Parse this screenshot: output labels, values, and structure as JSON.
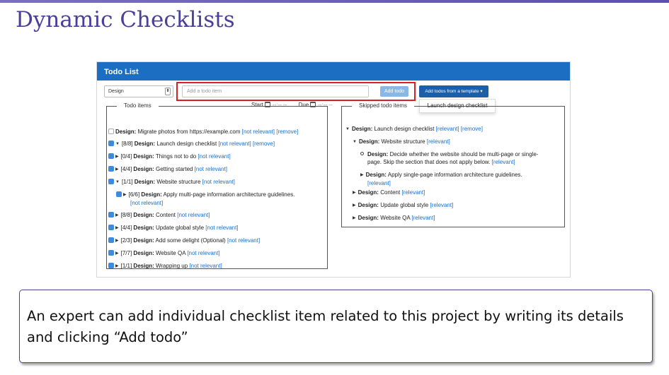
{
  "slide": {
    "title": "Dynamic Checklists",
    "caption": "An expert can add individual checklist item related to this project by writing its details and clicking “Add todo”"
  },
  "app": {
    "title": "Todo List",
    "category_select": "Design",
    "todo_input_placeholder": "Add a todo item",
    "add_button": "Add todo",
    "template_button": "Add todos from a template ▾",
    "template_menu_item": "Launch design checklist",
    "start_label": "Start",
    "due_label": "Due",
    "time_placeholder": "--:-- --"
  },
  "todo_items": {
    "legend": "Todo items",
    "items": [
      {
        "level": 0,
        "check": "off",
        "expand": "",
        "count": "",
        "prefix": "Design:",
        "text": "Migrate photos from https://example.com",
        "links": "[not relevant] [remove]"
      },
      {
        "level": 0,
        "check": "on",
        "expand": "▼",
        "count": "[8/8]",
        "prefix": "Design:",
        "text": "Launch design checklist",
        "links": "[not relevant] [remove]"
      },
      {
        "level": 1,
        "check": "on",
        "expand": "▶",
        "count": "[0/4]",
        "prefix": "Design:",
        "text": "Things not to do",
        "links": "[not relevant]"
      },
      {
        "level": 1,
        "check": "on",
        "expand": "▶",
        "count": "[4/4]",
        "prefix": "Design:",
        "text": "Getting started",
        "links": "[not relevant]"
      },
      {
        "level": 1,
        "check": "on",
        "expand": "▼",
        "count": "[1/1]",
        "prefix": "Design:",
        "text": "Website structure",
        "links": "[not relevant]"
      },
      {
        "level": 2,
        "check": "on",
        "expand": "▶",
        "count": "[6/6]",
        "prefix": "Design:",
        "text": "Apply multi-page information architecture guidelines.",
        "links": "[not relevant]"
      },
      {
        "level": 1,
        "check": "on",
        "expand": "▶",
        "count": "[8/8]",
        "prefix": "Design:",
        "text": "Content",
        "links": "[not relevant]"
      },
      {
        "level": 1,
        "check": "on",
        "expand": "▶",
        "count": "[4/4]",
        "prefix": "Design:",
        "text": "Update global style",
        "links": "[not relevant]"
      },
      {
        "level": 1,
        "check": "on",
        "expand": "▶",
        "count": "[2/3]",
        "prefix": "Design:",
        "text": "Add some delight (Optional)",
        "links": "[not relevant]"
      },
      {
        "level": 1,
        "check": "on",
        "expand": "▶",
        "count": "[7/7]",
        "prefix": "Design:",
        "text": "Website QA",
        "links": "[not relevant]"
      },
      {
        "level": 1,
        "check": "on",
        "expand": "▶",
        "count": "[1/1]",
        "prefix": "Design:",
        "text": "Wrapping up",
        "links": "[not relevant]"
      }
    ]
  },
  "skipped_items": {
    "legend": "Skipped todo items",
    "items": [
      {
        "level": 0,
        "marker": "▼",
        "prefix": "Design:",
        "text": "Launch design checklist",
        "links": "[relevant] [remove]"
      },
      {
        "level": 1,
        "marker": "▼",
        "prefix": "Design:",
        "text": "Website structure",
        "links": "[relevant]"
      },
      {
        "level": 2,
        "marker": "bullet",
        "prefix": "Design:",
        "text": "Decide whether the website should be multi-page or single-",
        "text2": "page. Skip the section that does not apply below.",
        "links": "[relevant]"
      },
      {
        "level": 2,
        "marker": "▶",
        "prefix": "Design:",
        "text": "Apply single-page information architecture guidelines.",
        "links": "[relevant]"
      },
      {
        "level": 1,
        "marker": "▶",
        "prefix": "Design:",
        "text": "Content",
        "links": "[relevant]"
      },
      {
        "level": 1,
        "marker": "▶",
        "prefix": "Design:",
        "text": "Update global style",
        "links": "[relevant]"
      },
      {
        "level": 1,
        "marker": "▶",
        "prefix": "Design:",
        "text": "Website QA",
        "links": "[relevant]"
      }
    ]
  }
}
